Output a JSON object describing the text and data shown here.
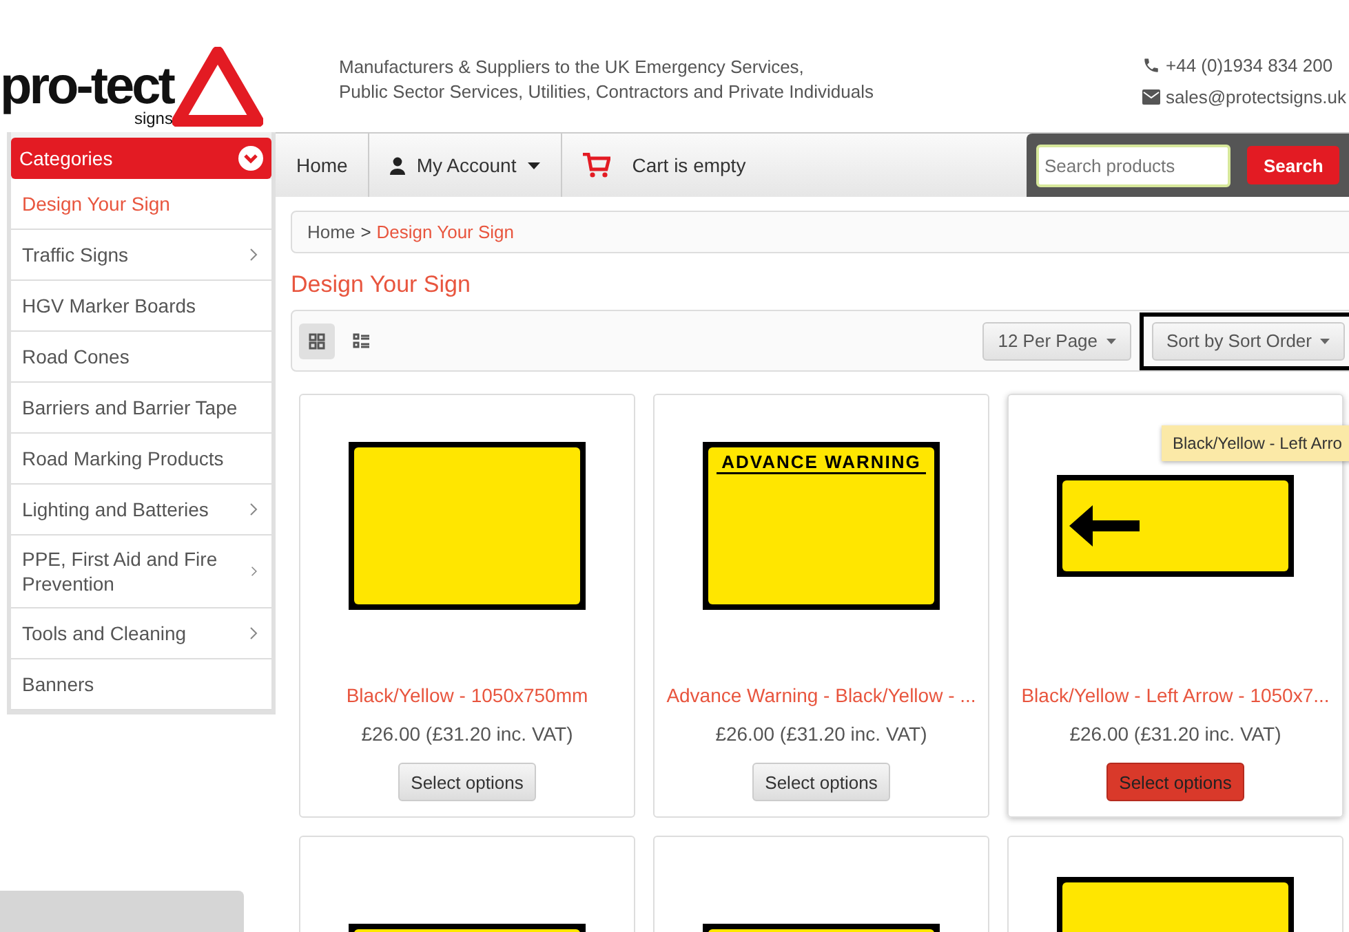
{
  "header": {
    "logo": {
      "name": "pro-tect",
      "sub": "signs"
    },
    "tagline": [
      "Manufacturers & Suppliers to the UK Emergency Services,",
      "Public Sector Services, Utilities, Contractors and Private Individuals"
    ],
    "phone": "+44 (0)1934 834 200",
    "email": "sales@protectsigns.uk"
  },
  "sidebar": {
    "title": "Categories",
    "items": [
      {
        "label": "Design Your Sign",
        "selected": true,
        "has_children": false
      },
      {
        "label": "Traffic Signs",
        "selected": false,
        "has_children": true
      },
      {
        "label": "HGV Marker Boards",
        "selected": false,
        "has_children": false
      },
      {
        "label": "Road Cones",
        "selected": false,
        "has_children": false
      },
      {
        "label": "Barriers and Barrier Tape",
        "selected": false,
        "has_children": false
      },
      {
        "label": "Road Marking Products",
        "selected": false,
        "has_children": false
      },
      {
        "label": "Lighting and Batteries",
        "selected": false,
        "has_children": true
      },
      {
        "label": "PPE, First Aid and Fire Prevention",
        "selected": false,
        "has_children": true
      },
      {
        "label": "Tools and Cleaning",
        "selected": false,
        "has_children": true
      },
      {
        "label": "Banners",
        "selected": false,
        "has_children": false
      }
    ]
  },
  "nav": {
    "home": "Home",
    "account": "My Account",
    "cart": "Cart is empty",
    "search": {
      "placeholder": "Search products",
      "button": "Search"
    }
  },
  "breadcrumb": [
    {
      "label": "Home",
      "current": false
    },
    {
      "label": "Design Your Sign",
      "current": true
    }
  ],
  "breadcrumb_separator": ">",
  "page_title": "Design Your Sign",
  "toolbar": {
    "views": [
      {
        "kind": "grid",
        "selected": true
      },
      {
        "kind": "list",
        "selected": false
      }
    ],
    "per_page": "12 Per Page",
    "sort": {
      "label": "Sort by Sort Order",
      "outlined": true
    }
  },
  "products": [
    {
      "kind": "blank",
      "name": "Black/Yellow - 1050x750mm",
      "price": "£26.00 (£31.20 inc. VAT)",
      "button": "Select options",
      "hovered": false
    },
    {
      "kind": "header",
      "sign_text": "ADVANCE WARNING",
      "name": "Advance Warning - Black/Yellow - ...",
      "price": "£26.00 (£31.20 inc. VAT)",
      "button": "Select options",
      "hovered": false
    },
    {
      "kind": "arrow",
      "name": "Black/Yellow - Left Arrow - 1050x7...",
      "price": "£26.00 (£31.20 inc. VAT)",
      "button": "Select options",
      "hovered": true,
      "tooltip": "Black/Yellow - Left Arro"
    }
  ],
  "more_products": [
    {
      "kind": "blank"
    },
    {
      "kind": "blank"
    },
    {
      "kind": "wide"
    }
  ]
}
